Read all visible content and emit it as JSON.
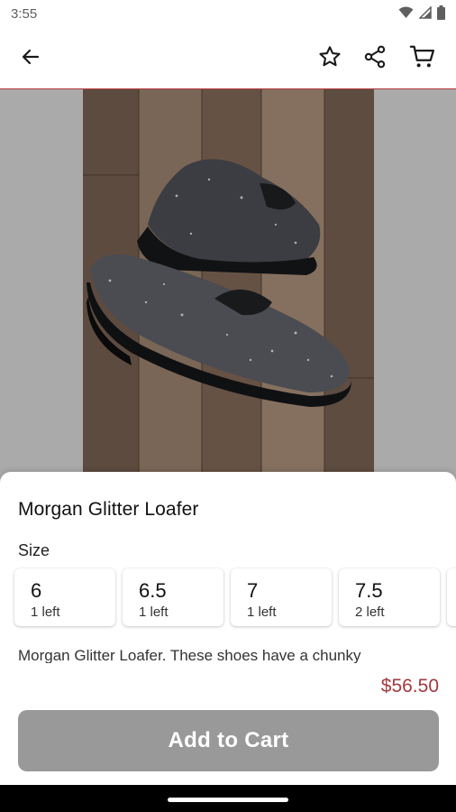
{
  "status_bar": {
    "time": "3:55",
    "icons": [
      "wifi-icon",
      "signal-icon",
      "battery-icon"
    ]
  },
  "app_bar": {
    "icons": [
      "back-arrow-icon",
      "star-icon",
      "share-icon",
      "cart-icon"
    ],
    "divider_color": "#b5383d"
  },
  "product": {
    "title": "Morgan Glitter Loafer",
    "size_heading": "Size",
    "sizes": [
      {
        "value": "6",
        "stock": "1 left"
      },
      {
        "value": "6.5",
        "stock": "1 left"
      },
      {
        "value": "7",
        "stock": "1 left"
      },
      {
        "value": "7.5",
        "stock": "2 left"
      }
    ],
    "description": "Morgan Glitter Loafer. These shoes have a chunky",
    "price": "$56.50"
  },
  "actions": {
    "add_to_cart_label": "Add to Cart"
  },
  "colors": {
    "accent": "#b5383d",
    "price": "#a23a3f",
    "button_disabled": "#999999"
  }
}
